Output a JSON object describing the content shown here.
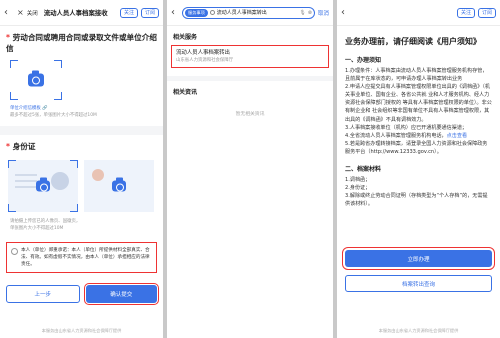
{
  "p1": {
    "back": "‹",
    "close_icon": "×",
    "close_label": "关闭",
    "title": "流动人员人事档案接收",
    "follow": "关注",
    "subscribe": "订阅",
    "sec1_star": "*",
    "sec1_title": "劳动合同或聘用合同或录取文件或单位介绍信",
    "sample_link": "单位介绍信模板",
    "sample_tail": "🔗",
    "upload_hint": "最多不超过5张，单张图片大小不得超过10M",
    "sec2_star": "*",
    "sec2_title": "身份证",
    "id_hint1": "请拍摄上传您已的人像页、国徽页，",
    "id_hint2": "单张图片大小不得超过10M",
    "agree_text": "本人（单位）郑重承诺：本人（单位）所提供材料全部真实、合法、有效。如有虚假不实情况，由本人（单位）承担相应的法律责任。",
    "prev_btn": "上一步",
    "submit_btn": "确认提交",
    "footer": "本服务由山东省人力资源和社会保障厅提供"
  },
  "p2": {
    "back": "‹",
    "search_tag": "服务事项",
    "search_value": "流动人员人事档案转出",
    "mic": "🎙",
    "clear": "⊗",
    "cancel": "取消",
    "section_service": "相关服务",
    "result_title": "流动人员人事档案转出",
    "result_sub": "山东省人力资源和社会保障厅",
    "section_news": "相关资讯",
    "empty": "暂无相关资讯"
  },
  "p3": {
    "back": "‹",
    "follow": "关注",
    "subscribe": "订阅",
    "headline": "业务办理前，请仔细阅读《用户须知》",
    "s1": "一、办理须知",
    "t1": "1.办理条件：人事档案由流动人员人事档案管理服务机构存管，且前属于在库状态的，可申请办理人事档案转出业务",
    "t2": "2.申请人应提交具有人事档案管理权限单位出具的《调档函》（机关事业单位、国有企业、各省公共就 业和人才服务机构、经人力资源社会保障部门授权的 等具有人事档案管理权限的单位）。非公有制企业和 社会组织等非国有单位不具有人事档案管理权限，其出具的《调档函》不具有调档效力。",
    "t3": "3.人事档案接收单位（机构）应已开通机要通信渠道；",
    "t4a": "4.全省流动人员人事档案管理服务机构电话，",
    "t4b": "点击查看",
    "t5": "5.若是跨省办理转接档案，请登录全国人力资源和社会保障政务服务平台（http://www.12333.gov.cn）。",
    "s2": "二、档案材料",
    "m1": "1.调档函；",
    "m2": "2.身份证；",
    "m3": "3.解除或终止劳动合同证明（存档类型为“个人存档”的，无需提供该材料）。",
    "btn_handle": "立即办理",
    "btn_query": "档案转出查询",
    "footer": "本服务由山东省人力资源和社会保障厅提供"
  },
  "colors": {
    "accent": "#3a72e5",
    "highlight": "#e33"
  }
}
